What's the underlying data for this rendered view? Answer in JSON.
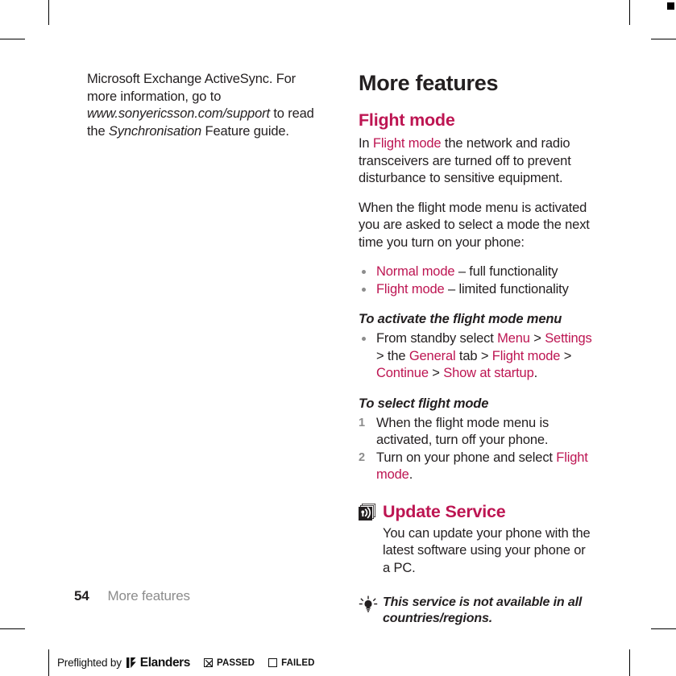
{
  "document": {
    "page_number": "54",
    "running_head": "More features"
  },
  "left_column": {
    "continued_paragraph": {
      "lead": "Microsoft Exchange ActiveSync. For more information, go to ",
      "url": "www.sonyericsson.com/support",
      "mid": " to read the ",
      "italic_term": "Synchronisation",
      "tail": " Feature guide."
    }
  },
  "right_column": {
    "chapter_title": "More features",
    "flight_mode": {
      "section_title": "Flight mode",
      "paragraph_1": {
        "pre": "In ",
        "term": "Flight mode",
        "post": " the network and radio transceivers are turned off to prevent disturbance to sensitive equipment."
      },
      "paragraph_2": "When the flight mode menu is activated you are asked to select a mode the next time you turn on your phone:",
      "modes": [
        {
          "term": "Normal mode",
          "description": " – full functionality"
        },
        {
          "term": "Flight mode",
          "description": " – limited functionality"
        }
      ],
      "procedure_activate": {
        "title": "To activate the flight mode menu",
        "step": {
          "p1": "From standby select ",
          "t1": "Menu",
          "s1": " > ",
          "t2": "Settings",
          "s2": " > the ",
          "t3": "General",
          "s3": " tab > ",
          "t4": "Flight mode",
          "s4": " > ",
          "t5": "Continue",
          "s5": " > ",
          "t6": "Show at startup",
          "s6": "."
        }
      },
      "procedure_select": {
        "title": "To select flight mode",
        "steps": [
          {
            "number": "1",
            "text": "When the flight mode menu is activated, turn off your phone."
          },
          {
            "number": "2",
            "pre": "Turn on your phone and select ",
            "term": "Flight mode",
            "post": "."
          }
        ]
      }
    },
    "update_service": {
      "icon": "broadcast-signal-icon",
      "section_title": "Update Service",
      "paragraph": "You can update your phone with the latest software using your phone or a PC.",
      "tip": {
        "icon": "lightbulb-tip-icon",
        "text": "This service is not available in all countries/regions."
      }
    }
  },
  "preflight_bar": {
    "label": "Preflighted by",
    "brand": "Elanders",
    "passed_label": "PASSED",
    "failed_label": "FAILED",
    "passed_checked": true,
    "failed_checked": false
  },
  "colors": {
    "accent_magenta": "#bd1552",
    "body_text": "#231f20",
    "muted_gray": "#8c8c8c"
  }
}
